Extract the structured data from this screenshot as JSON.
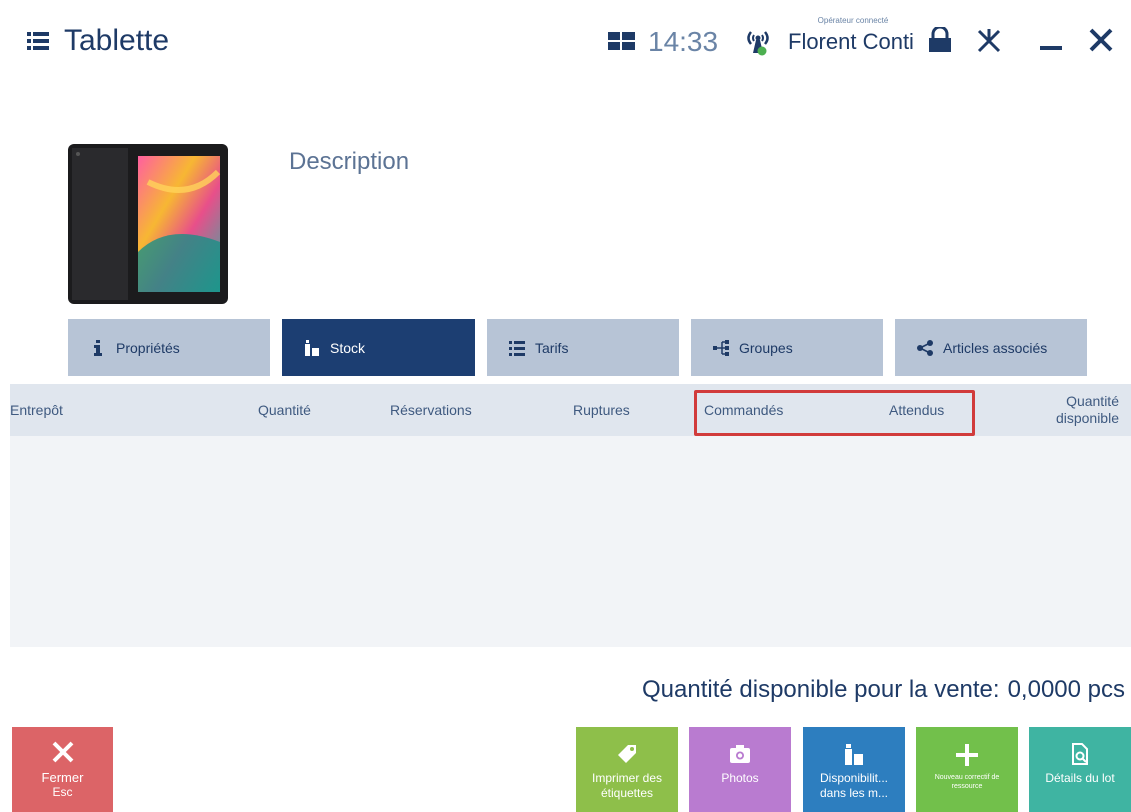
{
  "header": {
    "title": "Tablette",
    "time": "14:33",
    "operator_caption": "Opérateur connecté",
    "operator_name": "Florent Conti"
  },
  "product": {
    "description_label": "Description"
  },
  "tabs": [
    {
      "label": "Propriétés",
      "icon": "info-icon",
      "active": false
    },
    {
      "label": "Stock",
      "icon": "warehouse-icon",
      "active": true
    },
    {
      "label": "Tarifs",
      "icon": "list-icon",
      "active": false
    },
    {
      "label": "Groupes",
      "icon": "groups-icon",
      "active": false
    },
    {
      "label": "Articles associés",
      "icon": "share-icon",
      "active": false
    }
  ],
  "table": {
    "columns": [
      "Entrepôt",
      "Quantité",
      "Réservations",
      "Ruptures",
      "Commandés",
      "Attendus",
      "Quantité disponible"
    ],
    "rows": []
  },
  "footer": {
    "availability_label": "Quantité disponible pour la vente:",
    "availability_value": "0,0000 pcs",
    "close_button": {
      "label": "Fermer",
      "shortcut": "Esc"
    },
    "actions": [
      {
        "label": "Imprimer des étiquettes",
        "icon": "tag-icon",
        "color": "#8ebf4a"
      },
      {
        "label": "Photos",
        "icon": "camera-icon",
        "color": "#b97bd0"
      },
      {
        "label": "Disponibilit... dans les m...",
        "icon": "warehouse-icon",
        "color": "#2d7ebf"
      },
      {
        "label": "Nouveau correctif de ressource",
        "icon": "plus-icon",
        "color": "#72c04b"
      },
      {
        "label": "Détails du lot",
        "icon": "document-search-icon",
        "color": "#3fb4a2"
      }
    ]
  },
  "colors": {
    "primary": "#1c3e72",
    "tab_inactive": "#b7c4d6",
    "close": "#dc6467",
    "highlight": "#d13b3b"
  }
}
